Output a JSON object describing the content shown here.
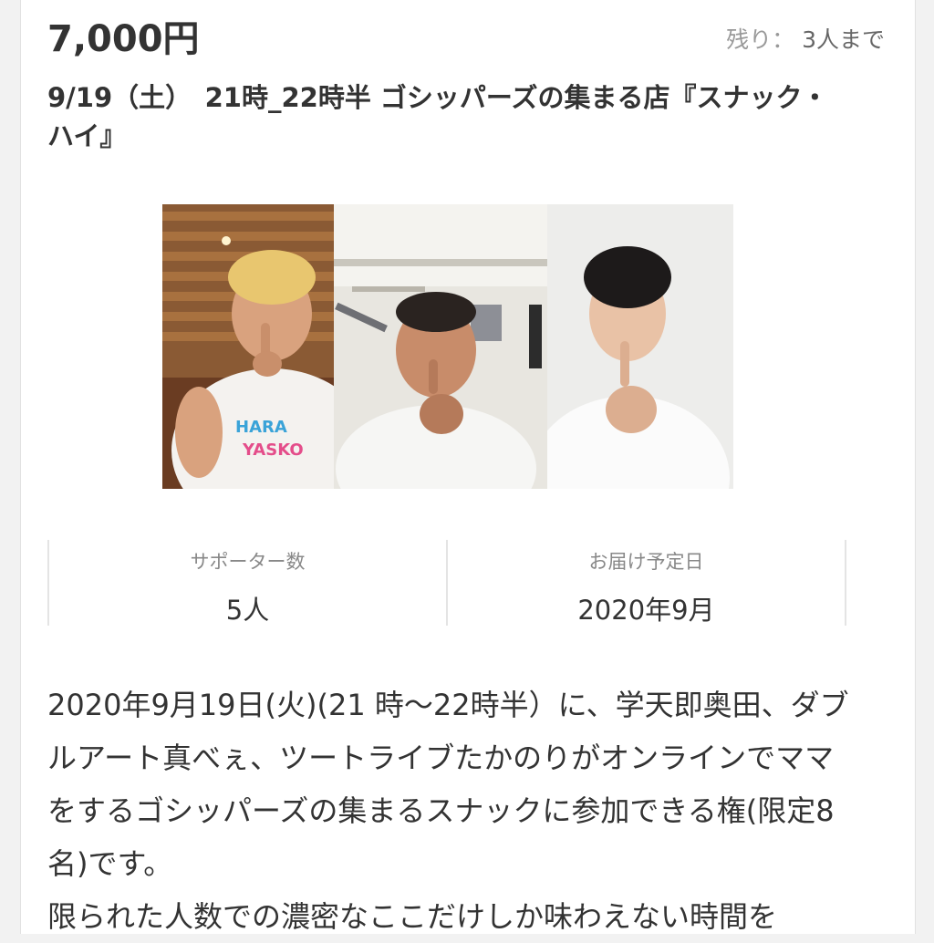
{
  "reward": {
    "price": "7,000円",
    "remaining_label": "残り：",
    "remaining_value": "3人まで",
    "title": "9/19（土）　21時_22時半 ゴシッパーズの集まる店『スナック・ハイ』"
  },
  "photos": [
    {
      "name": "photo-person-blonde",
      "shirt_text": "HARA YASUKO"
    },
    {
      "name": "photo-person-dark-hair"
    },
    {
      "name": "photo-person-white-shirt"
    }
  ],
  "stats": {
    "supporters_label": "サポーター数",
    "supporters_value": "5人",
    "delivery_label": "お届け予定日",
    "delivery_value": "2020年9月"
  },
  "description": {
    "paragraph1": "2020年9月19日(火)(21 時〜22時半）に、学天即奥田、ダブルアート真べぇ、ツートライブたかのりがオンラインでママをするゴシッパーズの集まるスナックに参加できる権(限定8名)です。",
    "paragraph2": "限られた人数での濃密なここだけしか味わえない時間を"
  },
  "colors": {
    "background": "#f2f2f2",
    "card": "#ffffff",
    "text": "#333333",
    "muted": "#999999",
    "divider": "#e4e4e4"
  }
}
